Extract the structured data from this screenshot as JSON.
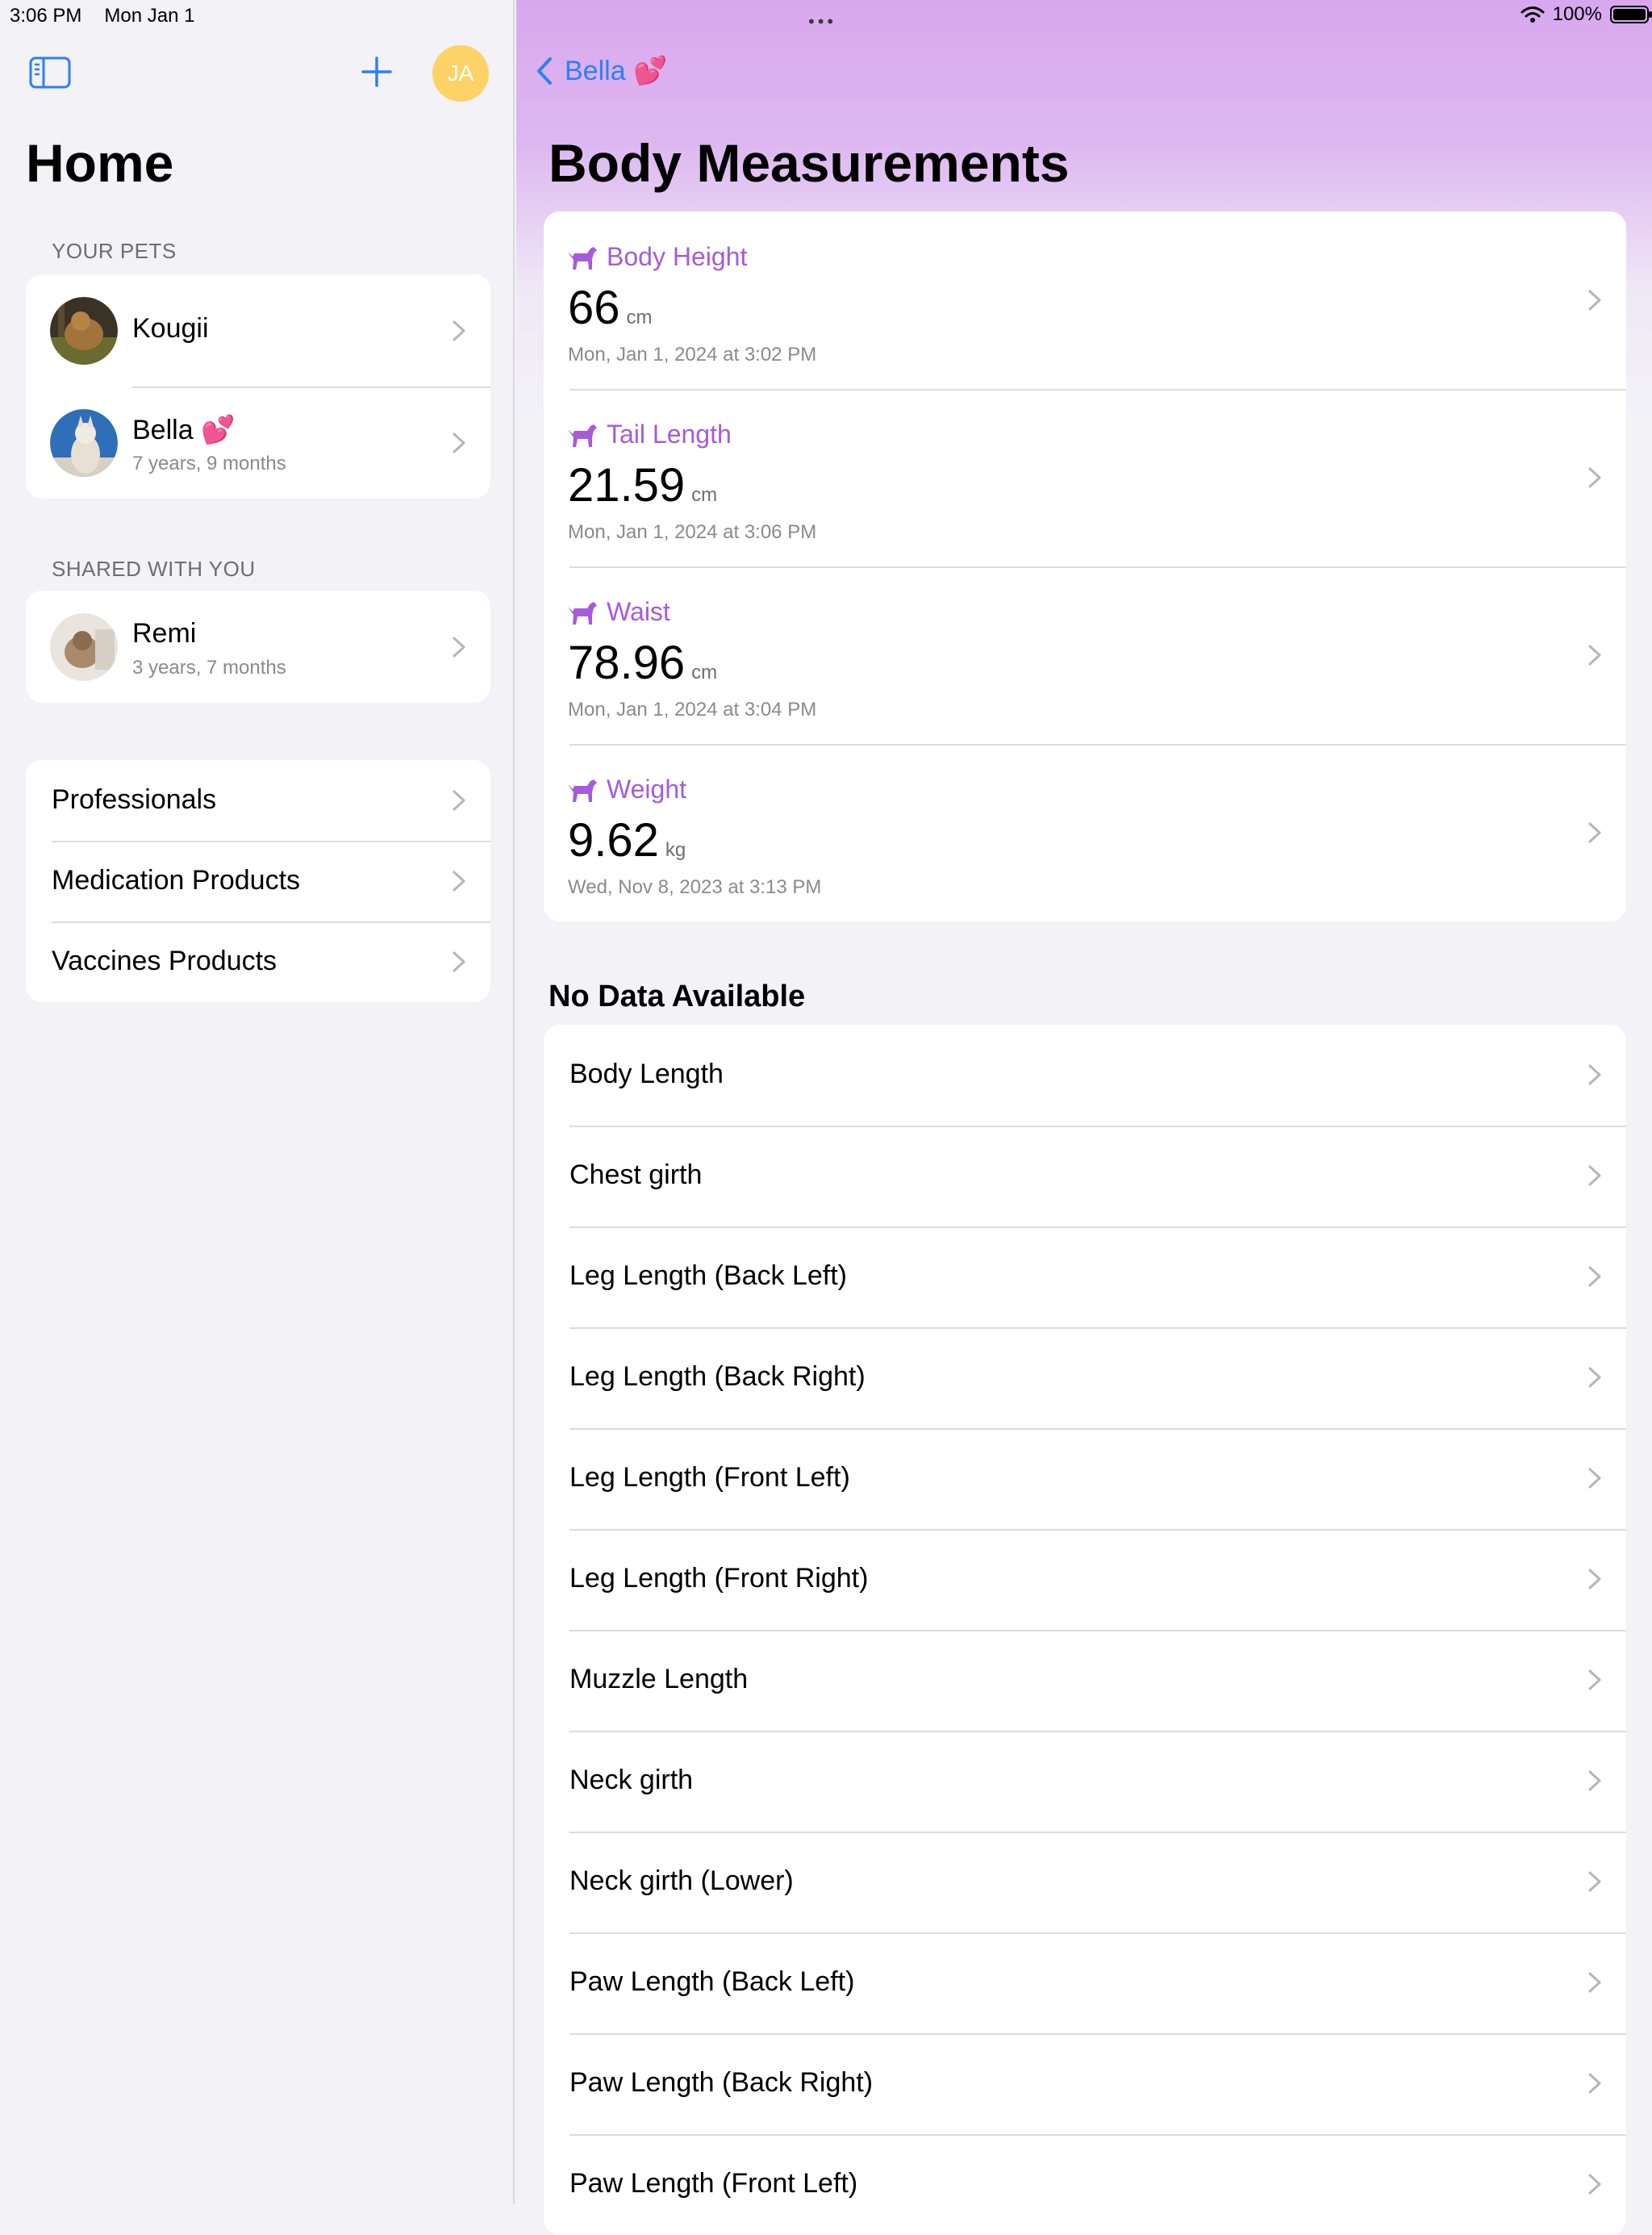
{
  "status_bar": {
    "time": "3:06 PM",
    "date": "Mon Jan 1",
    "battery": "100%"
  },
  "sidebar": {
    "title": "Home",
    "avatar_initials": "JA",
    "your_pets_header": "YOUR PETS",
    "pets": [
      {
        "name": "Kougii",
        "age": ""
      },
      {
        "name": "Bella 💕",
        "age": "7 years, 9 months"
      }
    ],
    "shared_header": "SHARED WITH YOU",
    "shared": [
      {
        "name": "Remi",
        "age": "3 years, 7 months"
      }
    ],
    "links": [
      "Professionals",
      "Medication Products",
      "Vaccines Products"
    ]
  },
  "main": {
    "back_label": "Bella 💕",
    "title": "Body Measurements",
    "measurements": [
      {
        "label": "Body Height",
        "value": "66",
        "unit": "cm",
        "date": "Mon, Jan 1, 2024 at 3:02 PM"
      },
      {
        "label": "Tail Length",
        "value": "21.59",
        "unit": "cm",
        "date": "Mon, Jan 1, 2024 at 3:06 PM"
      },
      {
        "label": "Waist",
        "value": "78.96",
        "unit": "cm",
        "date": "Mon, Jan 1, 2024 at 3:04 PM"
      },
      {
        "label": "Weight",
        "value": "9.62",
        "unit": "kg",
        "date": "Wed, Nov 8, 2023 at 3:13 PM"
      }
    ],
    "no_data_title": "No Data Available",
    "no_data_items": [
      "Body Length",
      "Chest girth",
      "Leg Length (Back Left)",
      "Leg Length (Back Right)",
      "Leg Length (Front Left)",
      "Leg Length (Front Right)",
      "Muzzle Length",
      "Neck girth",
      "Neck girth (Lower)",
      "Paw Length (Back Left)",
      "Paw Length (Back Right)",
      "Paw Length (Front Left)"
    ]
  },
  "colors": {
    "accent": "#2f7ef6",
    "measure_accent": "#a55bdb",
    "avatar": "#fdd266"
  }
}
